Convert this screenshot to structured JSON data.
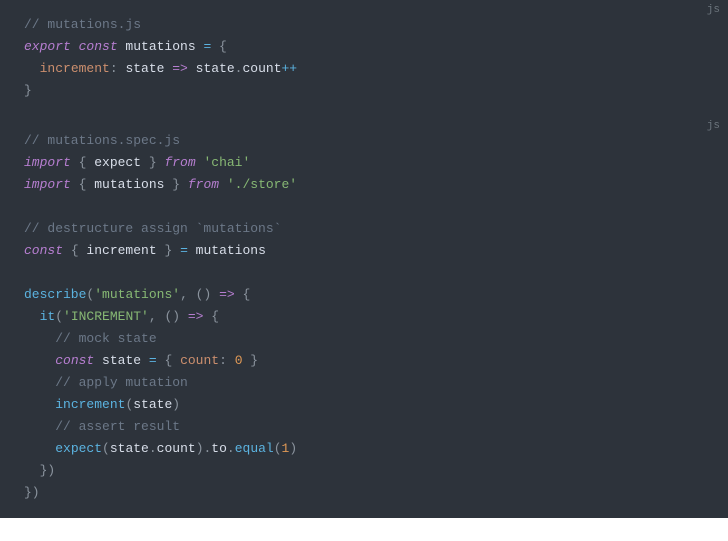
{
  "blocks": [
    {
      "lang": "js",
      "tokens": [
        [
          [
            "c-comment",
            "// mutations.js"
          ]
        ],
        [
          [
            "c-keyword",
            "export"
          ],
          [
            "",
            ""
          ],
          [
            "c-keyword2",
            " const"
          ],
          [
            "",
            ""
          ],
          [
            "c-name",
            " mutations"
          ],
          [
            "c-op",
            " ="
          ],
          [
            "c-punct",
            " {"
          ]
        ],
        [
          [
            "",
            "  "
          ],
          [
            "c-prop",
            "increment"
          ],
          [
            "c-punct",
            ":"
          ],
          [
            "",
            ""
          ],
          [
            "c-name",
            " state"
          ],
          [
            "c-arrow",
            " =>"
          ],
          [
            "",
            ""
          ],
          [
            "c-name",
            " state"
          ],
          [
            "c-punct",
            "."
          ],
          [
            "c-name",
            "count"
          ],
          [
            "c-op",
            "++"
          ]
        ],
        [
          [
            "c-punct",
            "}"
          ]
        ]
      ]
    },
    {
      "lang": "js",
      "tokens": [
        [
          [
            "c-comment",
            "// mutations.spec.js"
          ]
        ],
        [
          [
            "c-keyword",
            "import"
          ],
          [
            "c-punct",
            " {"
          ],
          [
            "c-name",
            " expect "
          ],
          [
            "c-punct",
            "}"
          ],
          [
            "c-keyword",
            " from"
          ],
          [
            "c-string",
            " 'chai'"
          ]
        ],
        [
          [
            "c-keyword",
            "import"
          ],
          [
            "c-punct",
            " {"
          ],
          [
            "c-name",
            " mutations "
          ],
          [
            "c-punct",
            "}"
          ],
          [
            "c-keyword",
            " from"
          ],
          [
            "c-string",
            " './store'"
          ]
        ],
        [
          [
            "",
            ""
          ]
        ],
        [
          [
            "c-comment",
            "// destructure assign `mutations`"
          ]
        ],
        [
          [
            "c-keyword",
            "const"
          ],
          [
            "c-punct",
            " {"
          ],
          [
            "c-name",
            " increment "
          ],
          [
            "c-punct",
            "}"
          ],
          [
            "c-op",
            " ="
          ],
          [
            "c-name",
            " mutations"
          ]
        ],
        [
          [
            "",
            ""
          ]
        ],
        [
          [
            "c-func",
            "describe"
          ],
          [
            "c-punct",
            "("
          ],
          [
            "c-string",
            "'mutations'"
          ],
          [
            "c-punct",
            ","
          ],
          [
            "c-punct",
            " ()"
          ],
          [
            "c-arrow",
            " =>"
          ],
          [
            "c-punct",
            " {"
          ]
        ],
        [
          [
            "",
            "  "
          ],
          [
            "c-func",
            "it"
          ],
          [
            "c-punct",
            "("
          ],
          [
            "c-string",
            "'INCREMENT'"
          ],
          [
            "c-punct",
            ","
          ],
          [
            "c-punct",
            " ()"
          ],
          [
            "c-arrow",
            " =>"
          ],
          [
            "c-punct",
            " {"
          ]
        ],
        [
          [
            "",
            "    "
          ],
          [
            "c-comment",
            "// mock state"
          ]
        ],
        [
          [
            "",
            "    "
          ],
          [
            "c-keyword",
            "const"
          ],
          [
            "c-name",
            " state"
          ],
          [
            "c-op",
            " ="
          ],
          [
            "c-punct",
            " {"
          ],
          [
            "c-prop",
            " count"
          ],
          [
            "c-punct",
            ":"
          ],
          [
            "c-num",
            " 0"
          ],
          [
            "c-punct",
            " }"
          ]
        ],
        [
          [
            "",
            "    "
          ],
          [
            "c-comment",
            "// apply mutation"
          ]
        ],
        [
          [
            "",
            "    "
          ],
          [
            "c-func",
            "increment"
          ],
          [
            "c-punct",
            "("
          ],
          [
            "c-name",
            "state"
          ],
          [
            "c-punct",
            ")"
          ]
        ],
        [
          [
            "",
            "    "
          ],
          [
            "c-comment",
            "// assert result"
          ]
        ],
        [
          [
            "",
            "    "
          ],
          [
            "c-func",
            "expect"
          ],
          [
            "c-punct",
            "("
          ],
          [
            "c-name",
            "state"
          ],
          [
            "c-punct",
            "."
          ],
          [
            "c-name",
            "count"
          ],
          [
            "c-punct",
            ")."
          ],
          [
            "c-name",
            "to"
          ],
          [
            "c-punct",
            "."
          ],
          [
            "c-func",
            "equal"
          ],
          [
            "c-punct",
            "("
          ],
          [
            "c-num",
            "1"
          ],
          [
            "c-punct",
            ")"
          ]
        ],
        [
          [
            "",
            "  "
          ],
          [
            "c-punct",
            "})"
          ]
        ],
        [
          [
            "c-punct",
            "})"
          ]
        ]
      ]
    }
  ]
}
